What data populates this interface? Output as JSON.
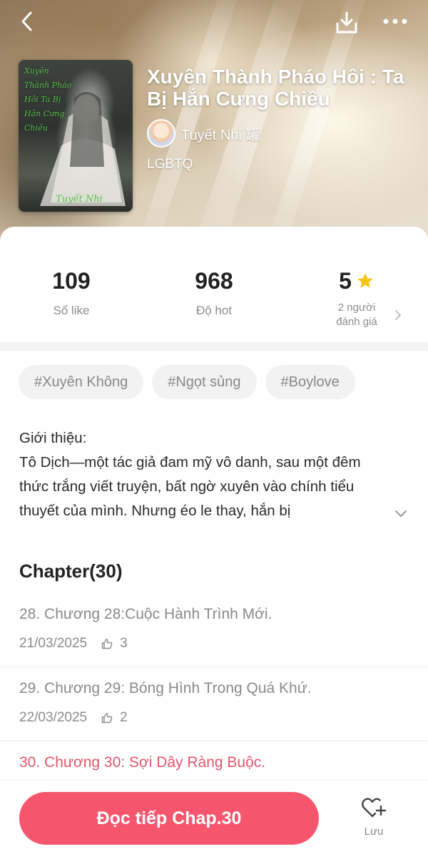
{
  "header": {
    "back_icon": "back-arrow-icon",
    "download_icon": "download-icon",
    "more_icon": "more-dots-icon"
  },
  "story": {
    "cover_text": "Xuyên Thành Pháo Hôi Ta Bị Hắn Cưng Chiều",
    "cover_author": "Tuyết Nhi",
    "title": "Xuyên Thành Pháo Hôi : Ta Bị Hắn Cưng Chiều",
    "author": "Tuyết Nhi 罐",
    "genre": "LGBTQ"
  },
  "stats": {
    "likes": {
      "value": "109",
      "label": "Số like"
    },
    "hot": {
      "value": "968",
      "label": "Độ hot"
    },
    "rating": {
      "value": "5",
      "label_line1": "2 người",
      "label_line2": "đánh giá"
    }
  },
  "tags": [
    "#Xuyên Không",
    "#Ngọt sủng",
    "#Boylove"
  ],
  "intro": {
    "heading": "Giới thiệu:",
    "text": "Tô Dịch—một tác giả đam mỹ vô danh, sau một đêm thức trắng viết truyện, bất ngờ xuyên vào chính tiểu thuyết của mình. Nhưng éo le thay, hắn bị"
  },
  "chapters": {
    "heading": "Chapter(30)",
    "items": [
      {
        "title": "28. Chương 28:Cuộc Hành Trình Mới.",
        "date": "21/03/2025",
        "likes": "3"
      },
      {
        "title": "29. Chương 29: Bóng Hình Trong Quá Khứ.",
        "date": "22/03/2025",
        "likes": "2"
      },
      {
        "title": "30. Chương 30: Sợi Dây Ràng Buộc."
      }
    ]
  },
  "bottom": {
    "read_label": "Đọc tiếp Chap.30",
    "save_label": "Lưu"
  },
  "colors": {
    "accent": "#f5566d",
    "current_chapter": "#e5546d",
    "star": "#f5c518"
  }
}
